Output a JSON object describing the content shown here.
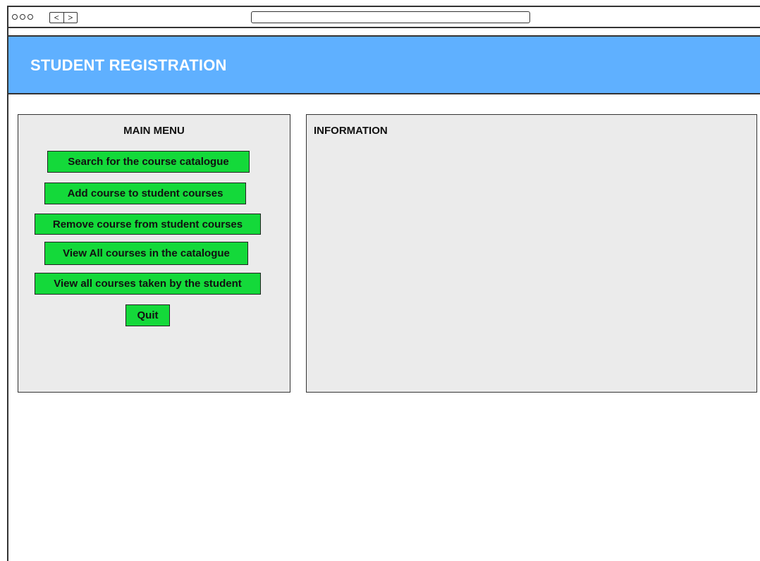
{
  "browser": {
    "icons": [
      "window-dot-icon",
      "back-arrow-icon",
      "forward-arrow-icon"
    ],
    "back_glyph": "<",
    "forward_glyph": ">"
  },
  "header": {
    "title": "STUDENT REGISTRATION",
    "background_color": "#5fb0ff"
  },
  "menu": {
    "title": "MAIN MENU",
    "button_color": "#14d93a",
    "buttons": [
      {
        "label": "Search for the course catalogue"
      },
      {
        "label": "Add course to student courses"
      },
      {
        "label": "Remove course from student courses"
      },
      {
        "label": "View All courses in the catalogue"
      },
      {
        "label": "View all courses taken by the student"
      },
      {
        "label": "Quit"
      }
    ]
  },
  "info": {
    "title": "INFORMATION"
  }
}
